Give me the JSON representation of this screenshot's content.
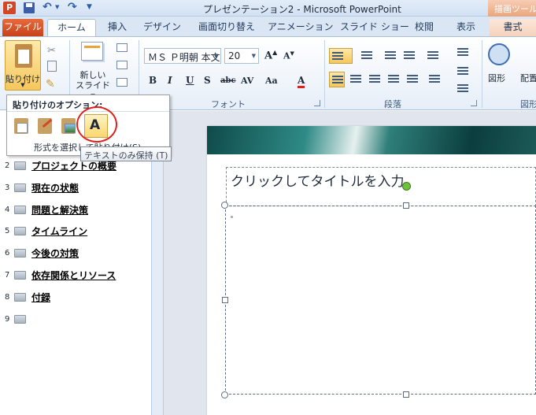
{
  "window": {
    "title": "プレゼンテーション2 - Microsoft PowerPoint",
    "context_tab_group": "描画ツール"
  },
  "tabs": [
    {
      "label": "ファイル"
    },
    {
      "label": "ホーム"
    },
    {
      "label": "挿入"
    },
    {
      "label": "デザイン"
    },
    {
      "label": "画面切り替え"
    },
    {
      "label": "アニメーション"
    },
    {
      "label": "スライド ショー"
    },
    {
      "label": "校閲"
    },
    {
      "label": "表示"
    },
    {
      "label": "書式"
    }
  ],
  "ribbon": {
    "paste_label": "貼り付け",
    "new_slide_label": "新しい\nスライド",
    "font_name": "ＭＳ Ｐ明朝 本文",
    "font_size": "20",
    "bold": "B",
    "italic": "I",
    "underline": "U",
    "shadow": "S",
    "strike": "abc",
    "spacing": "AV",
    "case": "Aa",
    "font_color": "A",
    "grow_font": "A",
    "shrink_font": "A",
    "font_group": "フォント",
    "paragraph_group": "段落",
    "shapes_label": "図形",
    "arrange_label": "配置",
    "drawing_group": "図形"
  },
  "paste_menu": {
    "heading": "貼り付けのオプション:",
    "text_only_glyph": "A",
    "paste_special": "形式を選択して貼り付け(S)...",
    "tooltip": "テキストのみ保持 (T)"
  },
  "outline": [
    {
      "num": "2",
      "text": "プロジェクトの概要"
    },
    {
      "num": "3",
      "text": "現在の状態"
    },
    {
      "num": "4",
      "text": "問題と解決策"
    },
    {
      "num": "5",
      "text": "タイムライン"
    },
    {
      "num": "6",
      "text": "今後の対策"
    },
    {
      "num": "7",
      "text": "依存関係とリソース"
    },
    {
      "num": "8",
      "text": "付録"
    },
    {
      "num": "9",
      "text": ""
    }
  ],
  "slide": {
    "title_prompt": "クリックしてタイトルを入力"
  },
  "colors": {
    "file_tab": "#d24726",
    "accent_gold": "#f6c65b",
    "highlight_ring": "#e0201a",
    "rotate_handle": "#6fc23c"
  }
}
